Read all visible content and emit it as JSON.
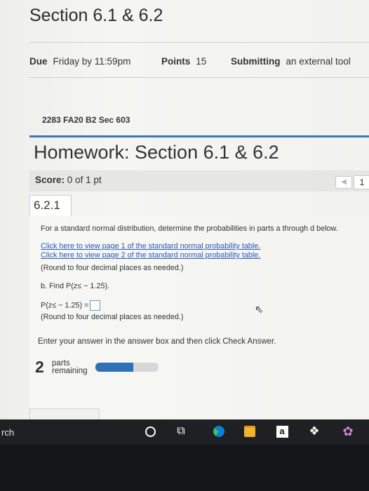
{
  "section_title": "Section 6.1 & 6.2",
  "meta": {
    "due_label": "Due",
    "due_value": "Friday by 11:59pm",
    "points_label": "Points",
    "points_value": "15",
    "submitting_label": "Submitting",
    "submitting_value": "an external tool"
  },
  "course": "2283 FA20 B2 Sec 603",
  "homework_title": "Homework: Section 6.1 & 6.2",
  "score": {
    "label": "Score:",
    "value": "0 of 1 pt"
  },
  "nav": {
    "prev_icon": "triangle-left-icon",
    "question_number": "1"
  },
  "question": {
    "number": "6.2.1",
    "prompt": "For a standard normal distribution, determine the probabilities in parts a through d below.",
    "link1": "Click here to view page 1 of the standard normal probability table.",
    "link2": "Click here to view page 2 of the standard normal probability table.",
    "round_note": "(Round to four decimal places as needed.)",
    "part_b": "b. Find P(z≤ − 1.25).",
    "answer_label": "P(z≤ − 1.25) =",
    "answer_value": "",
    "round_note2": "(Round to four decimal places as needed.)"
  },
  "instruction": "Enter your answer in the answer box and then click Check Answer.",
  "progress": {
    "parts_count": "2",
    "parts_line1": "parts",
    "parts_line2": "remaining",
    "fill_fraction": 0.6
  },
  "taskbar": {
    "search_fragment": "rch",
    "icons": [
      "cortana-circle-icon",
      "task-view-icon",
      "edge-icon",
      "file-explorer-icon",
      "amazon-icon",
      "dropbox-icon",
      "app-icon"
    ],
    "amazon_letter": "a"
  },
  "colors": {
    "accent_blue": "#3d78b3",
    "link_blue": "#2b58b6",
    "progress_fill": "#2f71b6"
  }
}
